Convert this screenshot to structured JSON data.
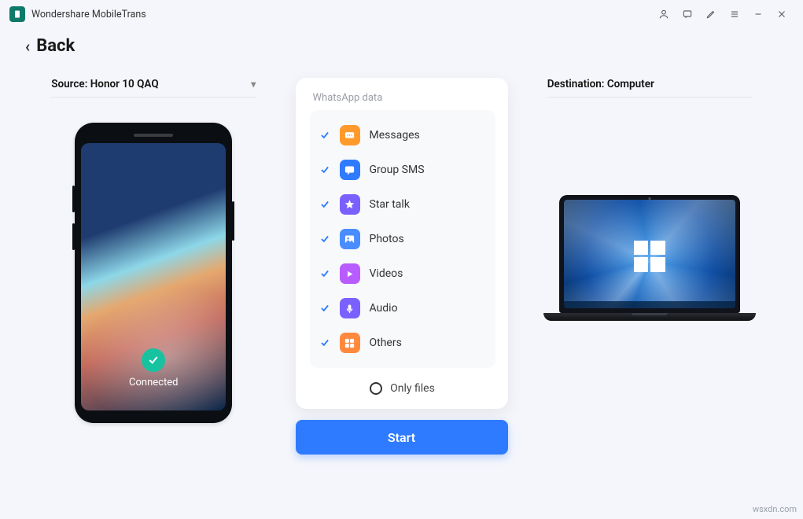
{
  "app": {
    "title": "Wondershare MobileTrans"
  },
  "nav": {
    "back": "Back"
  },
  "source": {
    "label_prefix": "Source: ",
    "device": "Honor 10 QAQ",
    "status": "Connected"
  },
  "destination": {
    "label_prefix": "Destination: ",
    "device": "Computer"
  },
  "panel": {
    "title": "WhatsApp data",
    "items": [
      {
        "label": "Messages",
        "checked": true,
        "color": "#ff9a2b"
      },
      {
        "label": "Group SMS",
        "checked": true,
        "color": "#2f7bff"
      },
      {
        "label": "Star talk",
        "checked": true,
        "color": "#7a60ff"
      },
      {
        "label": "Photos",
        "checked": true,
        "color": "#4a8dff"
      },
      {
        "label": "Videos",
        "checked": true,
        "color": "#b85cff"
      },
      {
        "label": "Audio",
        "checked": true,
        "color": "#7a60ff"
      },
      {
        "label": "Others",
        "checked": true,
        "color": "#ff8a3d"
      }
    ],
    "only_files": "Only files"
  },
  "actions": {
    "start": "Start"
  },
  "watermark": "wsxdn.com"
}
